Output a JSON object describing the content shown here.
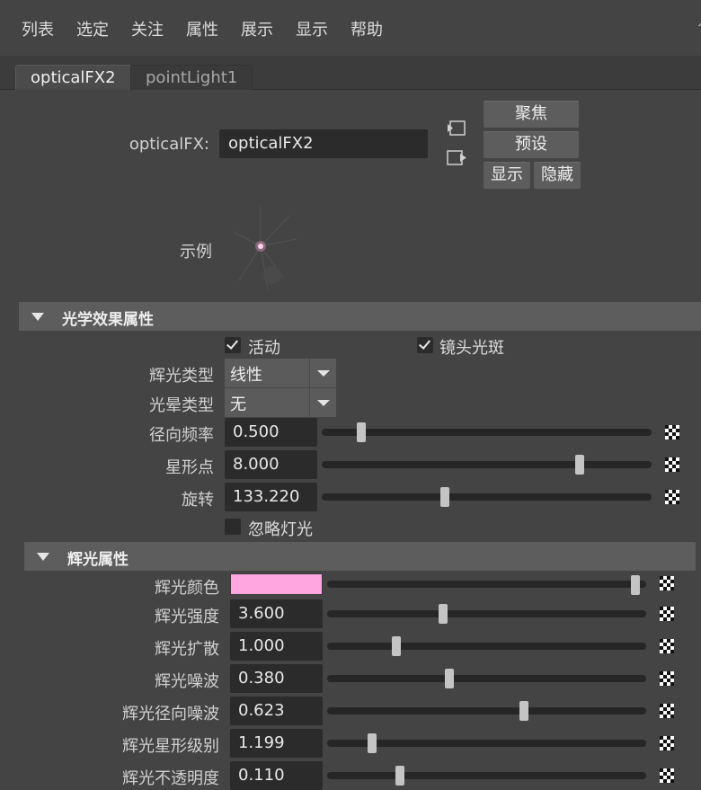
{
  "menu": [
    "列表",
    "选定",
    "关注",
    "属性",
    "展示",
    "显示",
    "帮助"
  ],
  "tabs": {
    "active": "opticalFX2",
    "inactive": "pointLight1"
  },
  "node": {
    "label": "opticalFX:",
    "value": "opticalFX2"
  },
  "buttons": {
    "focus": "聚焦",
    "preset": "预设",
    "show": "显示",
    "hide": "隐藏"
  },
  "sample_label": "示例",
  "section_optical": {
    "title": "光学效果属性",
    "active_label": "活动",
    "active_checked": true,
    "lens_flare_label": "镜头光斑",
    "lens_flare_checked": true,
    "glow_type_label": "辉光类型",
    "glow_type_value": "线性",
    "halo_type_label": "光晕类型",
    "halo_type_value": "无",
    "sliders": [
      {
        "label": "径向频率",
        "value": "0.500",
        "fraction": 0.11
      },
      {
        "label": "星形点",
        "value": "8.000",
        "fraction": 0.79
      },
      {
        "label": "旋转",
        "value": "133.220",
        "fraction": 0.37
      }
    ],
    "ignore_light_label": "忽略灯光",
    "ignore_light_checked": false
  },
  "section_glow": {
    "title": "辉光属性",
    "color_label": "辉光颜色",
    "color_value": "#ffa6df",
    "color_fraction": 0.98,
    "sliders": [
      {
        "label": "辉光强度",
        "value": "3.600",
        "fraction": 0.36
      },
      {
        "label": "辉光扩散",
        "value": "1.000",
        "fraction": 0.21
      },
      {
        "label": "辉光噪波",
        "value": "0.380",
        "fraction": 0.38
      },
      {
        "label": "辉光径向噪波",
        "value": "0.623",
        "fraction": 0.62
      },
      {
        "label": "辉光星形级别",
        "value": "1.199",
        "fraction": 0.13
      },
      {
        "label": "辉光不透明度",
        "value": "0.110",
        "fraction": 0.22
      }
    ]
  }
}
